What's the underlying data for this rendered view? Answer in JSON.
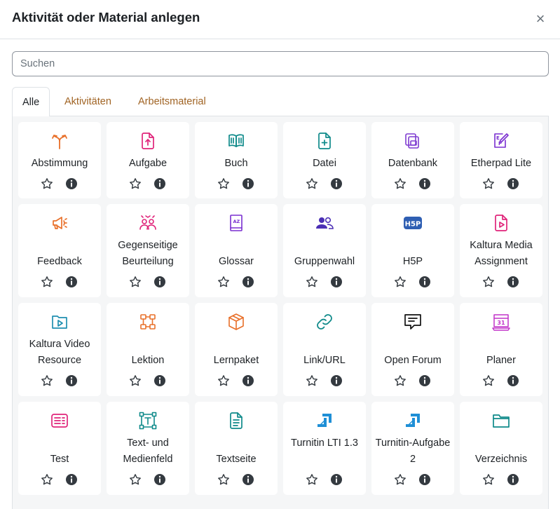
{
  "dialog": {
    "title": "Aktivität oder Material anlegen",
    "close_symbol": "×"
  },
  "search": {
    "placeholder": "Suchen",
    "value": ""
  },
  "tabs": [
    {
      "label": "Alle",
      "active": true
    },
    {
      "label": "Aktivitäten",
      "active": false
    },
    {
      "label": "Arbeitsmaterial",
      "active": false
    }
  ],
  "colors": {
    "link": "#a06323",
    "panel_bg": "#f5f6f7",
    "icon_orange": "#f7634d",
    "icon_pink": "#eb66a2",
    "icon_teal": "#399be2",
    "icon_purple": "#a378ff"
  },
  "items": [
    {
      "label": "Abstimmung",
      "icon": "choice-icon"
    },
    {
      "label": "Aufgabe",
      "icon": "assignment-upload-icon"
    },
    {
      "label": "Buch",
      "icon": "book-icon"
    },
    {
      "label": "Datei",
      "icon": "file-icon"
    },
    {
      "label": "Datenbank",
      "icon": "database-icon"
    },
    {
      "label": "Etherpad Lite",
      "icon": "etherpad-icon"
    },
    {
      "label": "Feedback",
      "icon": "megaphone-icon"
    },
    {
      "label": "Gegenseitige Beurteilung",
      "icon": "workshop-icon"
    },
    {
      "label": "Glossar",
      "icon": "glossary-icon"
    },
    {
      "label": "Gruppenwahl",
      "icon": "group-choice-icon"
    },
    {
      "label": "H5P",
      "icon": "h5p-icon"
    },
    {
      "label": "Kaltura Media Assignment",
      "icon": "kaltura-assignment-icon"
    },
    {
      "label": "Kaltura Video Resource",
      "icon": "kaltura-video-icon"
    },
    {
      "label": "Lektion",
      "icon": "lesson-icon"
    },
    {
      "label": "Lernpaket",
      "icon": "scorm-package-icon"
    },
    {
      "label": "Link/URL",
      "icon": "link-icon"
    },
    {
      "label": "Open Forum",
      "icon": "forum-icon"
    },
    {
      "label": "Planer",
      "icon": "calendar-icon"
    },
    {
      "label": "Test",
      "icon": "quiz-icon"
    },
    {
      "label": "Text- und Medienfeld",
      "icon": "text-media-icon"
    },
    {
      "label": "Textseite",
      "icon": "page-icon"
    },
    {
      "label": "Turnitin LTI 1.3",
      "icon": "turnitin-icon"
    },
    {
      "label": "Turnitin-Aufgabe 2",
      "icon": "turnitin-icon"
    },
    {
      "label": "Verzeichnis",
      "icon": "folder-icon"
    }
  ],
  "actions": {
    "star": "star-icon",
    "info": "info-icon"
  }
}
